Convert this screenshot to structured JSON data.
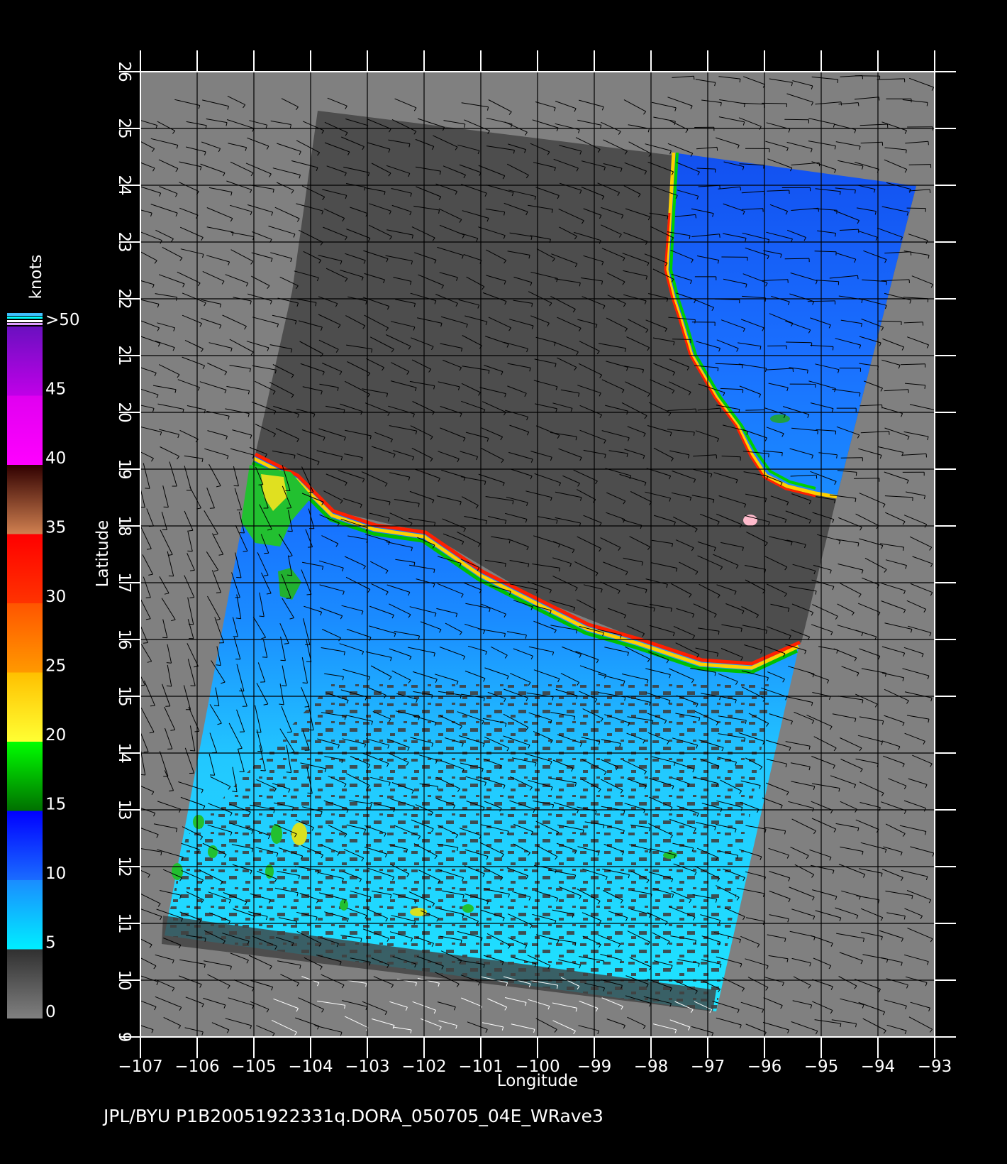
{
  "map": {
    "xlabel": "Longitude",
    "ylabel": "Latitude",
    "xlim": [
      -107,
      -93
    ],
    "ylim": [
      9,
      26
    ],
    "lon_ticks": [
      "−107",
      "−106",
      "−105",
      "−104",
      "−103",
      "−102",
      "−101",
      "−100",
      "−99",
      "−98",
      "−97",
      "−96",
      "−95",
      "−94",
      "−93"
    ],
    "lat_ticks": [
      "9",
      "10",
      "11",
      "12",
      "13",
      "14",
      "15",
      "16",
      "17",
      "18",
      "19",
      "20",
      "21",
      "22",
      "23",
      "24",
      "25",
      "26"
    ],
    "colors": {
      "background": "#000000",
      "no_data": "#808080",
      "land": "#4d4d4d",
      "grid": "#000000",
      "wind_barbs": "#000000"
    }
  },
  "colorbar": {
    "units": "knots",
    "labels": [
      "0",
      "5",
      "10",
      "15",
      "20",
      "25",
      "30",
      "35",
      "40",
      "45",
      ">50"
    ],
    "bands": [
      {
        "min": 0,
        "max": 5,
        "color_low": "#808080",
        "color_high": "#303030"
      },
      {
        "min": 5,
        "max": 10,
        "color_low": "#00eeff",
        "color_high": "#1a8cff"
      },
      {
        "min": 10,
        "max": 15,
        "color_low": "#1a6cff",
        "color_high": "#0000ff"
      },
      {
        "min": 15,
        "max": 20,
        "color_low": "#007000",
        "color_high": "#00ff00"
      },
      {
        "min": 20,
        "max": 25,
        "color_low": "#ffff33",
        "color_high": "#ffc000"
      },
      {
        "min": 25,
        "max": 30,
        "color_low": "#ff9900",
        "color_high": "#ff5500"
      },
      {
        "min": 30,
        "max": 35,
        "color_low": "#ff3300",
        "color_high": "#ff0000"
      },
      {
        "min": 35,
        "max": 40,
        "color_low": "#d08050",
        "color_high": "#300000"
      },
      {
        "min": 40,
        "max": 45,
        "color_low": "#ff00ff",
        "color_high": "#e000f0"
      },
      {
        "min": 45,
        "max": 50,
        "color_low": "#c000e8",
        "color_high": "#6a10c0"
      }
    ]
  },
  "footer": "JPL/BYU  P1B20051922331q.DORA_050705_04E_WRave3"
}
